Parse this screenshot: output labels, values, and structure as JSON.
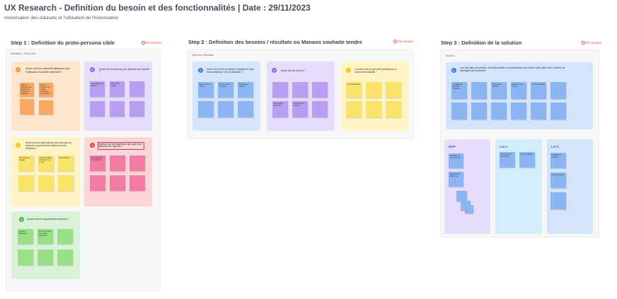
{
  "header": {
    "title": "UX Research - Definition du besoin et des fonctionnalités | Date : 29/11/2023",
    "subtitle": "Historisation des datasets et l'utilisation de l'historisation"
  },
  "steps": [
    {
      "title": "Step 1 : Definition du proto-persona cible",
      "timer": "20 minutes",
      "board_label": "Utilisateur - Pierre Dan"
    },
    {
      "title": "Step 2 : Definition des besoins / résultats où Manaos souhaite tendre",
      "timer": "15 minutes",
      "board_label": "Besoins / Résultats"
    },
    {
      "title": "Step 3 : Definition de la solution",
      "timer": "20 minutes",
      "board_label": "Solution"
    }
  ],
  "step1_sections": [
    {
      "num": "1",
      "question": "Quels sont les objectifs atteignés que l'utilisateur souhaite atteindre ?"
    },
    {
      "num": "2",
      "question": "Quels sont les besoins pour atteindre ses objectifs ?"
    },
    {
      "num": "3",
      "question": "Quels sont les observations que nous avez pu retrouver concernant les actions de votre utilisateur ?"
    },
    {
      "num": "4",
      "question": "Quelles sont les frustrations que porte pour atteindre ses objectifs ?"
    },
    {
      "num": "5",
      "question": "Quelles sont les opportunités retournées ?"
    }
  ],
  "step2_sections": [
    {
      "num": "1",
      "question": "Quels ont sont les résultats ou objectifs de haut niveau attendus / de cet utilisateur ?"
    },
    {
      "num": "2",
      "question": "Quels sont les besoins ?"
    },
    {
      "num": "3",
      "question": "Comment est-ce que notre produit peut ou cherche les objectifs ?"
    }
  ],
  "step3": {
    "num": "1",
    "question": "Lors des idées de produits, de fonctionnalités ou d'améliorations qui aident votre public cible à obtenir les avantages qu'il recherche.",
    "columns": [
      "MVP",
      "Lot 1",
      "Lot 2"
    ]
  },
  "sticky_texts": {
    "s1_orange_a": "Avoir un historique des datasets et pouvoir en l'utilisation",
    "s1_orange_b": "Pouvoir retrouver une version précédente d'un dataset",
    "s1_purple_a": "Sauvegarder les datasets",
    "s1_purple_b": "Savoir qui a modifié",
    "s1_yellow_a": "Recherche de dataset",
    "s1_yellow_b": "Quand est utilisé par rapport au temps",
    "s1_yellow_c": "Pas consacré",
    "s1_pink_a": "Pas d'historique sur la donnée",
    "s1_green_a": "Création d'historique",
    "s1_green_b": "Pouvoir retrouver une version précédente",
    "s2_blue_a": "Savoir ce qui a changé",
    "s2_blue_b": "Pouvoir revenir en arrière",
    "s2_blue_c": "Historiser les datasets",
    "s2_purple_a": "Sauvegarder l'historique",
    "s2_purple_b": "Comparer deux versions",
    "s2_yellow_a": "Les historisations",
    "s3_top_a": "Possibilité de visualiser l'historique",
    "s3_top_b": "Visualiser les versions",
    "s3_top_c": "Restaurer une version",
    "s3_top_d": "Pouvoir comparer",
    "s3_mvp_a": "Possibilité de voir l'historique",
    "s3_mvp_b": "Visualiser les différences",
    "s3_lot1_a": "Pouvoir garder une version",
    "s3_lot1_b": "Voir quel dataset",
    "s3_lot2_a": "Possibilité de comparer",
    "s3_lot2_b": "Pouvoir exporter"
  },
  "colors": {
    "orange_bg": "#fde4cc",
    "orange_note": "#f7a862",
    "purple_bg": "#e6dcfb",
    "purple_note": "#b89ef3",
    "yellow_bg": "#fdf3c4",
    "yellow_note": "#fae36a",
    "pink_bg": "#fbd5d8",
    "pink_note": "#f07ba5",
    "green_bg": "#d9f1d6",
    "green_note": "#98df85",
    "blue_bg": "#d4e5fb",
    "blue_note": "#8bb5f3",
    "lightblue_bg": "#d2eefc",
    "num_orange": "#f0913a",
    "num_purple": "#8e68e6",
    "num_yellow": "#f2c500",
    "num_red": "#e5483d",
    "num_green": "#4bb543",
    "num_blue": "#3b7be0"
  }
}
